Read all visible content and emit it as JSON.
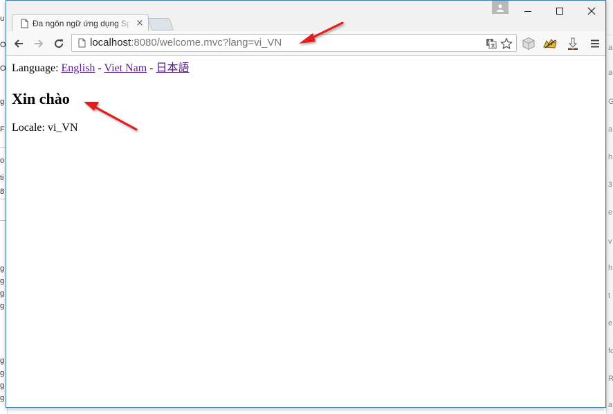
{
  "browser": {
    "tab": {
      "title": "Đa ngôn ngữ ứng dụng Spring MVC",
      "close_symbol": "×"
    },
    "window_controls": {
      "minimize": "–",
      "maximize": "☐",
      "close": "✕"
    },
    "toolbar": {
      "url_host": "localhost",
      "url_rest": ":8080/welcome.mvc?lang=vi_VN",
      "icons": [
        "back-icon",
        "forward-icon",
        "reload-icon",
        "page-icon",
        "translate-icon",
        "bookmark-star-icon",
        "extension-box-icon",
        "extension-tomcat-icon",
        "extension-download-icon",
        "menu-icon"
      ]
    }
  },
  "page": {
    "language_label": "Language:",
    "separator": "-",
    "languages": [
      "English",
      "Viet Nam",
      "日本語"
    ],
    "heading": "Xin chào",
    "locale_label": "Locale:",
    "locale_value": "vi_VN"
  },
  "annotations": {
    "arrow_color": "#e41a1a"
  }
}
